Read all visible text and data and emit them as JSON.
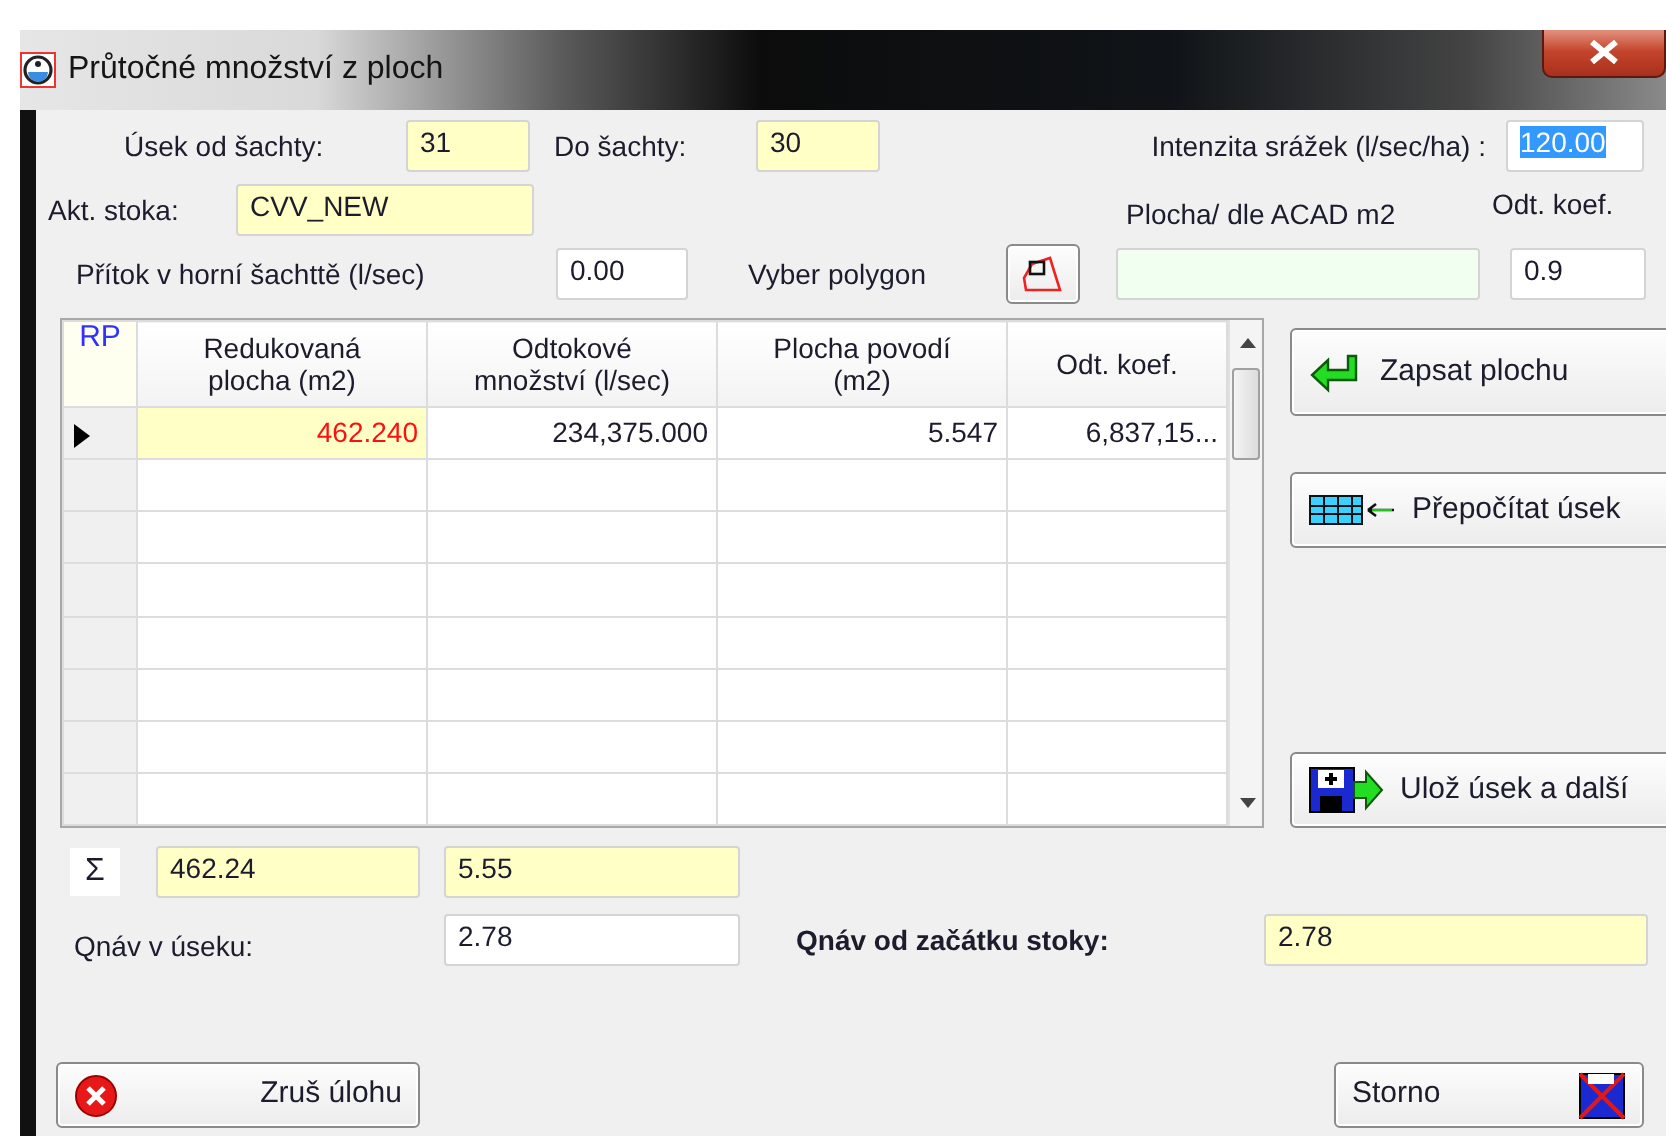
{
  "window": {
    "title": "Průtočné množství z ploch"
  },
  "usek_od": {
    "label": "Úsek od šachty:",
    "value": "31",
    "kind": "readonly"
  },
  "do_sachty": {
    "label": "Do šachty:",
    "value": "30",
    "kind": "readonly"
  },
  "intenzita": {
    "label": "Intenzita srážek (l/sec/ha) :",
    "value": "120.00",
    "kind": "editable",
    "selected": true
  },
  "akt_stoka": {
    "label": "Akt. stoka:",
    "value": "CVV_NEW",
    "kind": "readonly"
  },
  "plocha_acad": {
    "label": "Plocha/ dle ACAD m2",
    "kind": "area"
  },
  "odt_koef": {
    "label": "Odt. koef.",
    "value": "0.9",
    "kind": "editable"
  },
  "pritok": {
    "label": "Přítok v horní šachttě (l/sec)",
    "value": "0.00",
    "kind": "editable"
  },
  "vyber_polygon": {
    "label": "Vyber polygon"
  },
  "table": {
    "row_header_label": "RP",
    "columns": [
      "Redukovaná plocha (m2)",
      "Odtokové množství (l/sec)",
      "Plocha povodí (m2)",
      "Odt. koef."
    ],
    "rows": [
      {
        "current": true,
        "cells": [
          "462.240",
          "234,375.000",
          "5.547",
          "6,837,15..."
        ]
      }
    ]
  },
  "side_buttons": [
    {
      "label": "Zapsat plochu",
      "kind": "enter"
    },
    {
      "label": "Přepočítat úsek",
      "kind": "recalc"
    },
    {
      "label": "Ulož úsek a další",
      "kind": "save"
    }
  ],
  "sum": {
    "symbol": "Σ",
    "values": [
      {
        "value": "462.24",
        "kind": "readonly"
      },
      {
        "value": "5.55",
        "kind": "readonly"
      }
    ]
  },
  "qnav_useku": {
    "label": "Qnáv v  úseku:",
    "value": "2.78",
    "kind": "editable"
  },
  "qnav_stoky": {
    "label": "Qnáv od začátku stoky:",
    "value": "2.78",
    "kind": "readonly"
  },
  "buttons": [
    {
      "label": "Zruš úlohu",
      "kind": "cancel"
    },
    {
      "label": "Storno",
      "kind": "storno"
    }
  ]
}
